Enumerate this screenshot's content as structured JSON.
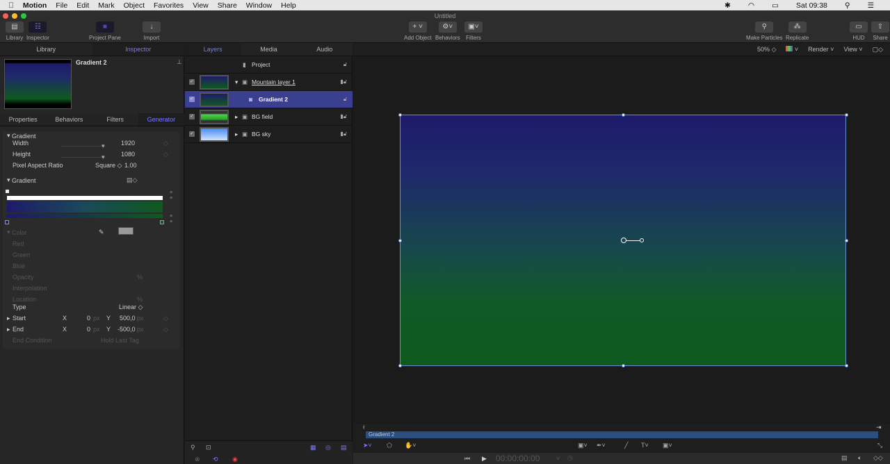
{
  "menubar": {
    "app": "Motion",
    "items": [
      "File",
      "Edit",
      "Mark",
      "Object",
      "Favorites",
      "View",
      "Share",
      "Window",
      "Help"
    ],
    "clock": "Sat 09:38"
  },
  "window": {
    "title": "Untitled"
  },
  "toolbar": {
    "library": "Library",
    "inspector": "Inspector",
    "project_pane": "Project Pane",
    "import": "Import",
    "add_object": "Add Object",
    "behaviors": "Behaviors",
    "filters": "Filters",
    "make_particles": "Make Particles",
    "replicate": "Replicate",
    "hud": "HUD",
    "share": "Share"
  },
  "left_tabs": [
    "Library",
    "Inspector"
  ],
  "inspector": {
    "object_name": "Gradient 2",
    "tabs": [
      "Properties",
      "Behaviors",
      "Filters",
      "Generator"
    ],
    "active_tab": "Generator",
    "section": "Gradient",
    "width_label": "Width",
    "width": "1920",
    "height_label": "Height",
    "height": "1080",
    "par_label": "Pixel Aspect Ratio",
    "par_mode": "Square",
    "par": "1.00",
    "gradient_label": "Gradient",
    "color_label": "Color",
    "red": "Red",
    "green": "Green",
    "blue": "Blue",
    "opacity": "Opacity",
    "interpolation": "Interpolation",
    "location": "Location",
    "pct": "%",
    "type_label": "Type",
    "type": "Linear",
    "start_label": "Start",
    "end_label": "End",
    "x": "X",
    "y": "Y",
    "px": "px",
    "start_x": "0",
    "start_y": "500,0",
    "end_x": "0",
    "end_y": "-500,0",
    "end_condition_label": "End Condition",
    "end_condition": "Hold Last Tag",
    "gradient_colors": {
      "start": "#1e1a6a",
      "end": "#0f5a1f"
    }
  },
  "layer_tabs": [
    "Layers",
    "Media",
    "Audio"
  ],
  "layers": {
    "project": "Project",
    "items": [
      {
        "name": "Mountain layer 1",
        "expanded": true,
        "selected": false
      },
      {
        "name": "Gradient 2",
        "selected": true
      },
      {
        "name": "BG field",
        "expanded": false,
        "selected": false
      },
      {
        "name": "BG sky",
        "expanded": false,
        "selected": false
      }
    ]
  },
  "viewer": {
    "zoom": "50%",
    "render": "Render",
    "view": "View"
  },
  "timeline": {
    "clip": "Gradient 2",
    "timecode": "00:00:00:00"
  }
}
